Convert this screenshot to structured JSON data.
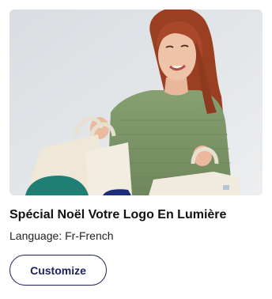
{
  "product": {
    "title": "Spécial Noël Votre Logo En Lumière",
    "language": "Language: Fr-French",
    "customize_label": "Customize"
  },
  "colors": {
    "button_border": "#1b1f5e",
    "photo_background": "#e4e7ea",
    "sweater": "#7c9468",
    "hair": "#9b3f22",
    "tote": "#f1ebde",
    "teal_bag": "#1f7f74",
    "navy_bag": "#1d2d7a"
  }
}
